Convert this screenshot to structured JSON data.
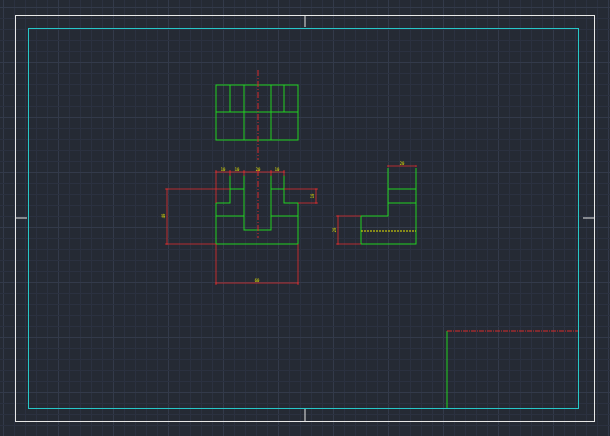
{
  "colors": {
    "background": "#252a34",
    "grid_minor": "#2b3140",
    "grid_major": "#333a4a",
    "sheet_border": "#e8e8e8",
    "frame": "#27c7c9",
    "object": "#21d321",
    "dimension": "#e62e2e",
    "centerline": "#d82a2a",
    "dim_text": "#e6e600"
  },
  "dimensions": {
    "front_top_1": "10",
    "front_top_2": "10",
    "front_top_3": "20",
    "front_top_4": "10",
    "front_height": "40",
    "front_step": "10",
    "front_width": "60",
    "side_top": "20",
    "side_height": "20"
  }
}
